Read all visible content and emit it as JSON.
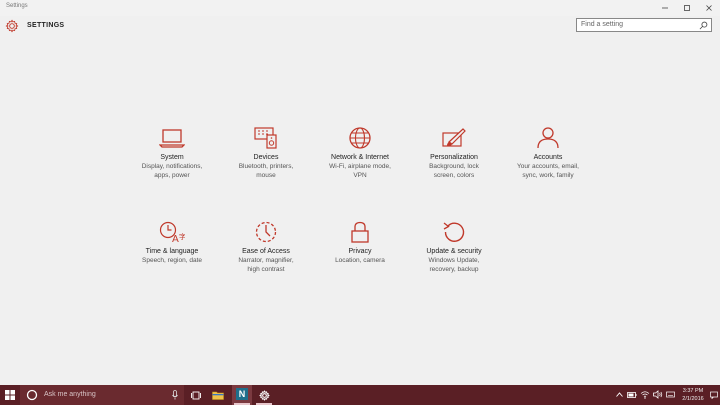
{
  "window": {
    "title": "Settings"
  },
  "header": {
    "title": "SETTINGS"
  },
  "search": {
    "placeholder": "Find a setting"
  },
  "accent": "#c0392b",
  "tiles": [
    {
      "title": "System",
      "desc": [
        "Display, notifications,",
        "apps, power"
      ],
      "icon": "laptop-icon"
    },
    {
      "title": "Devices",
      "desc": [
        "Bluetooth, printers,",
        "mouse"
      ],
      "icon": "devices-icon"
    },
    {
      "title": "Network & Internet",
      "desc": [
        "Wi-Fi, airplane mode,",
        "VPN"
      ],
      "icon": "globe-icon"
    },
    {
      "title": "Personalization",
      "desc": [
        "Background, lock",
        "screen, colors"
      ],
      "icon": "paint-icon"
    },
    {
      "title": "Accounts",
      "desc": [
        "Your accounts, email,",
        "sync, work, family"
      ],
      "icon": "person-icon"
    },
    {
      "title": "Time & language",
      "desc": [
        "Speech, region, date"
      ],
      "icon": "clock-language-icon"
    },
    {
      "title": "Ease of Access",
      "desc": [
        "Narrator, magnifier,",
        "high contrast"
      ],
      "icon": "ease-access-icon"
    },
    {
      "title": "Privacy",
      "desc": [
        "Location, camera"
      ],
      "icon": "lock-icon"
    },
    {
      "title": "Update & security",
      "desc": [
        "Windows Update,",
        "recovery, backup"
      ],
      "icon": "refresh-icon"
    }
  ],
  "taskbar": {
    "search_placeholder": "Ask me anything",
    "clock_time": "3:37 PM",
    "clock_date": "2/1/2016"
  }
}
